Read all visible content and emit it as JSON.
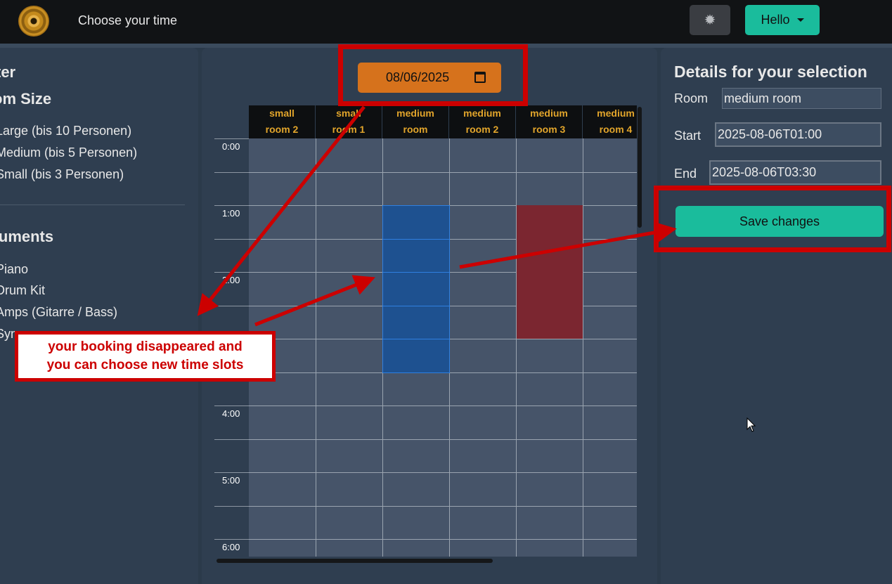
{
  "header": {
    "title": "Choose your time",
    "user_button": "Hello"
  },
  "icons": {
    "logo": "vinyl-record-logo",
    "theme": "sun-icon",
    "calendar": "calendar-icon"
  },
  "filter": {
    "title": "ter",
    "room_size_heading": "om Size",
    "room_sizes": [
      "Large (bis 10 Personen)",
      "Medium (bis 5 Personen)",
      "Small (bis 3 Personen)"
    ],
    "instruments_heading": "truments",
    "instruments": [
      "Piano",
      "Drum Kit",
      "Amps (Gitarre / Bass)",
      "Syn"
    ]
  },
  "date_picker": {
    "value": "08/06/2025"
  },
  "calendar": {
    "rooms": [
      [
        "small",
        "room 2"
      ],
      [
        "small",
        "room 1"
      ],
      [
        "medium",
        "room"
      ],
      [
        "medium",
        "room 2"
      ],
      [
        "medium",
        "room 3"
      ],
      [
        "medium",
        "room 4"
      ]
    ],
    "time_labels": [
      "0:00",
      "1:00",
      "2:00",
      "3:00",
      "4:00",
      "5:00",
      "6:00"
    ],
    "selected_room_index": 2,
    "selected_start": "1:00",
    "selected_end": "3:30",
    "booked_room_index": 4,
    "booked_start": "1:00",
    "booked_end": "3:00"
  },
  "details": {
    "title": "Details for your selection",
    "room_label": "Room",
    "room_value": "medium room",
    "start_label": "Start",
    "start_value": "2025-08-06T01:00",
    "end_label": "End",
    "end_value": "2025-08-06T03:30",
    "save_label": "Save changes"
  },
  "annotation": {
    "text_line1": "your booking disappeared and",
    "text_line2": "you can choose new time slots"
  },
  "colors": {
    "accent": "#1abc9c",
    "date_picker": "#d6721c",
    "room_header_text": "#e2a52b",
    "selected_slot": "#1e5190",
    "booked_slot": "#7b2630",
    "annotation_red": "#cc0000"
  }
}
